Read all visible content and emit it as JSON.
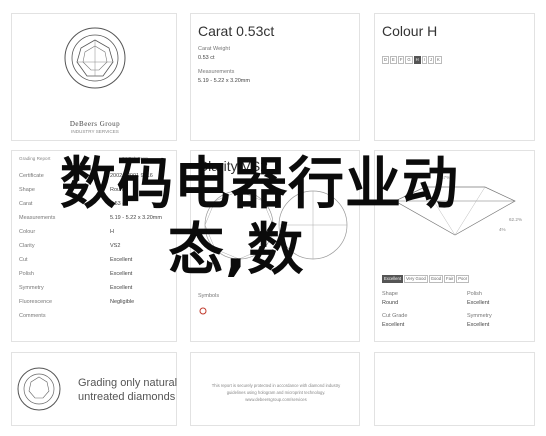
{
  "cert": {
    "title_prefix": "Carat",
    "title_value": "0.53ct",
    "rows": [
      {
        "label": "Carat Weight",
        "value": "0.53 ct"
      },
      {
        "label": "Measurements",
        "value": "5.19 - 5.22 x 3.20mm"
      }
    ]
  },
  "colour": {
    "title_prefix": "Colour",
    "title_value": "H",
    "scale": [
      "D",
      "E",
      "F",
      "G",
      "H",
      "I",
      "J",
      "K"
    ],
    "active": "H"
  },
  "logo": {
    "ring_text": "INSTITUTE OF DIAMONDS",
    "brand": "DeBeers Group",
    "sub": "INDUSTRY SERVICES"
  },
  "grading": {
    "heading": "Grading Report",
    "date": "04 Feb 2019",
    "rows": [
      {
        "label": "Certificate",
        "value": "20024 2001 9016"
      },
      {
        "label": "Shape",
        "value": "Round"
      },
      {
        "label": "Carat",
        "value": "0.53 ct"
      },
      {
        "label": "Measurements",
        "value": "5.19 - 5.22 x 3.20mm"
      },
      {
        "label": "Colour",
        "value": "H"
      },
      {
        "label": "Clarity",
        "value": "VS2"
      },
      {
        "label": "Cut",
        "value": "Excellent"
      },
      {
        "label": "Polish",
        "value": "Excellent"
      },
      {
        "label": "Symmetry",
        "value": "Excellent"
      },
      {
        "label": "Fluorescence",
        "value": "Negligible"
      },
      {
        "label": "Comments",
        "value": ""
      }
    ]
  },
  "clarity": {
    "title_prefix": "Clarity",
    "title_value": "VS2",
    "symbols_label": "Symbols"
  },
  "proportions": {
    "pct1": "57%",
    "pct2": "62.2%",
    "pct3": "4%",
    "cut_scale": [
      "Excellent",
      "Very Good",
      "Good",
      "Fair",
      "Poor"
    ],
    "rows": [
      {
        "label": "Shape",
        "value": "Round"
      },
      {
        "label": "Polish",
        "value": "Excellent"
      },
      {
        "label": "Cut Grade",
        "value": "Excellent"
      },
      {
        "label": "Symmetry",
        "value": "Excellent"
      }
    ]
  },
  "footer": {
    "tagline_l1": "Grading only natural",
    "tagline_l2": "untreated diamonds",
    "notice_l1": "This report is securely protected in accordance with diamond industry",
    "notice_l2": "guidelines using hologram and microprint technology.",
    "notice_l3": "www.debeersgroup.com/services"
  },
  "overlay": {
    "text_line1": "数码电器行业动",
    "text_line2": "态,数"
  }
}
